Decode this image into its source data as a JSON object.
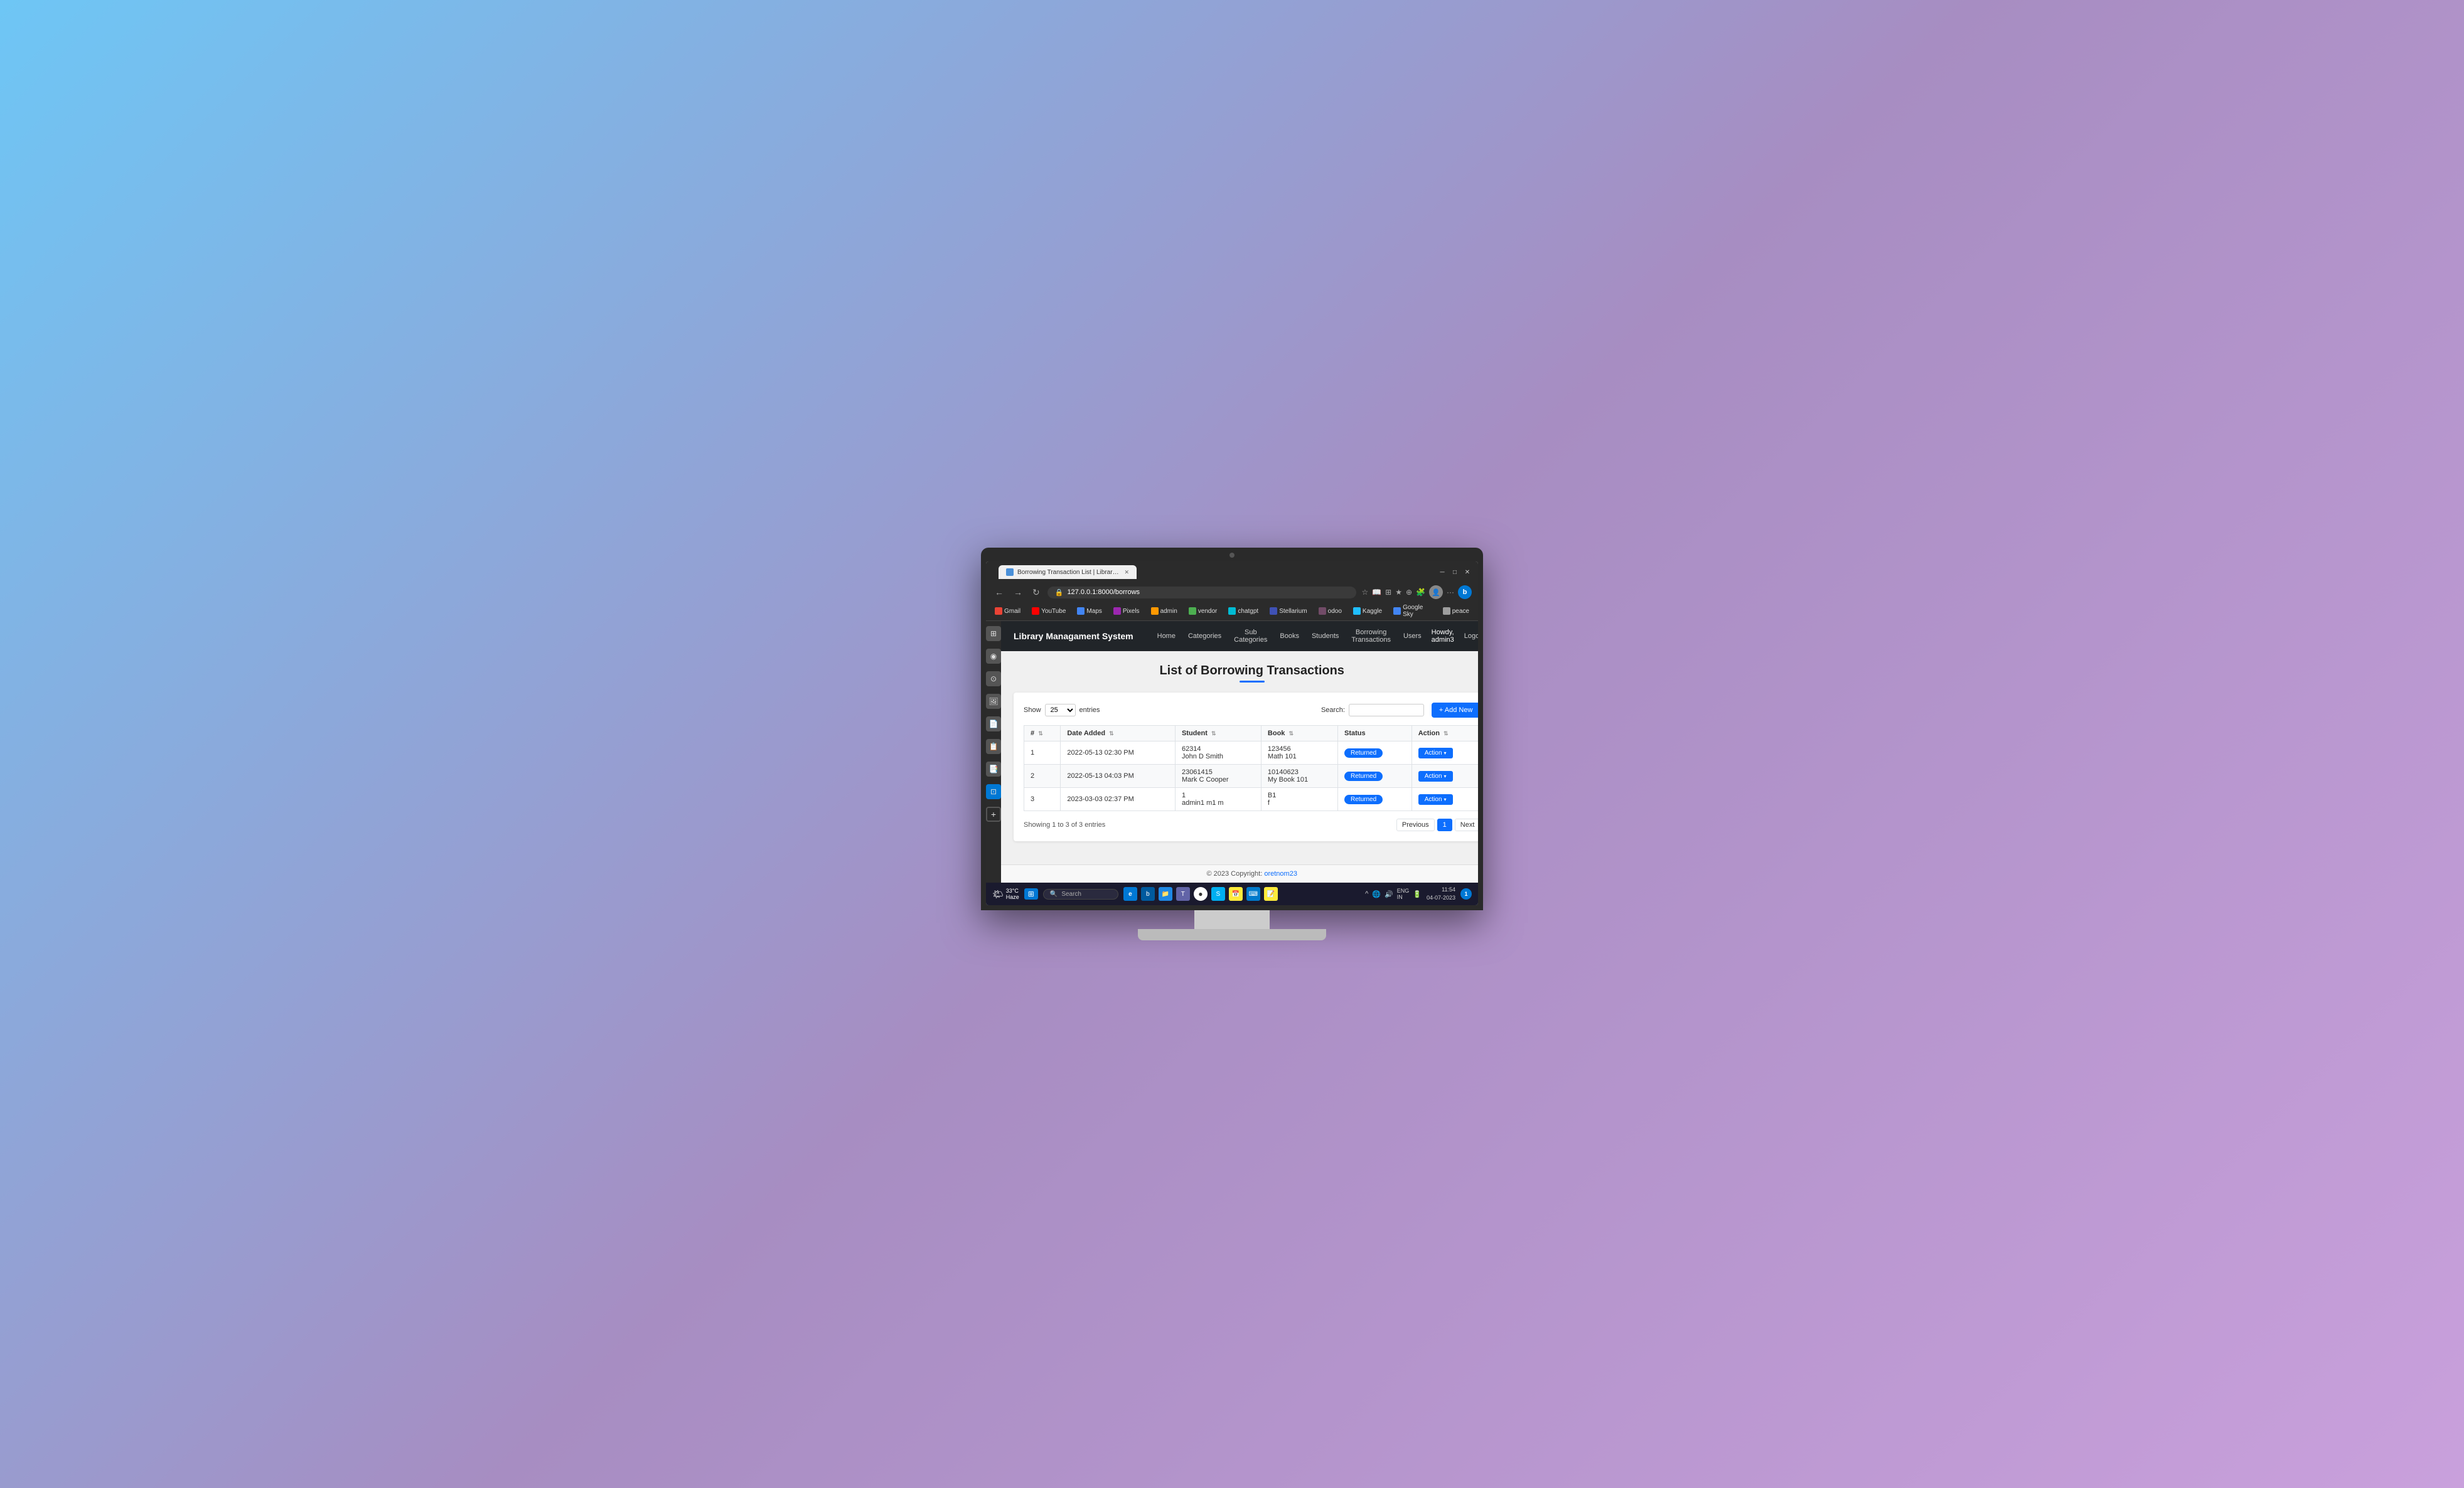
{
  "monitor": {
    "camera_label": "camera"
  },
  "browser": {
    "tab_title": "Borrowing Transaction List | Library Managament System",
    "address": "127.0.0.1:8000/borrows",
    "address_prefix": "127.0.0.1:8000",
    "address_path": "/borrows"
  },
  "bookmarks": [
    {
      "id": "gmail",
      "label": "Gmail",
      "color_class": "bm-gmail"
    },
    {
      "id": "youtube",
      "label": "YouTube",
      "color_class": "bm-yt"
    },
    {
      "id": "maps",
      "label": "Maps",
      "color_class": "bm-maps"
    },
    {
      "id": "pixels",
      "label": "Pixels",
      "color_class": "bm-pixels"
    },
    {
      "id": "admin",
      "label": "admin",
      "color_class": "bm-admin"
    },
    {
      "id": "vendor",
      "label": "vendor",
      "color_class": "bm-vendor"
    },
    {
      "id": "chatgpt",
      "label": "chatgpt",
      "color_class": "bm-chat"
    },
    {
      "id": "stellarium",
      "label": "Stellarium",
      "color_class": "bm-stellarium"
    },
    {
      "id": "odoo",
      "label": "odoo",
      "color_class": "bm-odoo"
    },
    {
      "id": "kaggle",
      "label": "Kaggle",
      "color_class": "bm-kaggle"
    },
    {
      "id": "googlesky",
      "label": "Google Sky",
      "color_class": "bm-googlesky"
    },
    {
      "id": "peace",
      "label": "peace",
      "color_class": "bm-peace"
    }
  ],
  "navbar": {
    "brand": "Library Managament System",
    "links": [
      {
        "label": "Home"
      },
      {
        "label": "Categories"
      },
      {
        "label": "Sub Categories"
      },
      {
        "label": "Books"
      },
      {
        "label": "Students"
      },
      {
        "label": "Borrowing Transactions"
      },
      {
        "label": "Users"
      },
      {
        "label": "Howdy, admin3"
      },
      {
        "label": "Logout"
      }
    ]
  },
  "page": {
    "title": "List of Borrowing Transactions",
    "add_new_label": "+ Add New",
    "show_label": "Show",
    "entries_label": "entries",
    "entries_value": "25",
    "search_label": "Search:",
    "search_placeholder": ""
  },
  "table": {
    "columns": [
      "#",
      "Date Added",
      "Student",
      "Book",
      "Status",
      "Action"
    ],
    "rows": [
      {
        "num": "1",
        "date_added": "2022-05-13 02:30 PM",
        "student_id": "62314",
        "student_name": "John D Smith",
        "book_id": "123456",
        "book_name": "Math 101",
        "status": "Returned",
        "action": "Action"
      },
      {
        "num": "2",
        "date_added": "2022-05-13 04:03 PM",
        "student_id": "23061415",
        "student_name": "Mark C Cooper",
        "book_id": "10140623",
        "book_name": "My Book 101",
        "status": "Returned",
        "action": "Action"
      },
      {
        "num": "3",
        "date_added": "2023-03-03 02:37 PM",
        "student_id": "1",
        "student_name": "admin1 m1 m",
        "book_id": "B1",
        "book_name": "f",
        "status": "Returned",
        "action": "Action"
      }
    ],
    "showing_text": "Showing 1 to 3 of 3 entries"
  },
  "pagination": {
    "prev_label": "Previous",
    "next_label": "Next",
    "current_page": "1"
  },
  "footer": {
    "text": "© 2023 Copyright:",
    "link_text": "oretnom23"
  },
  "taskbar": {
    "weather": "33°C\nHaze",
    "search_placeholder": "Search",
    "clock_time": "11:54",
    "clock_date": "04-07-2023",
    "lang": "ENG\nIN"
  }
}
